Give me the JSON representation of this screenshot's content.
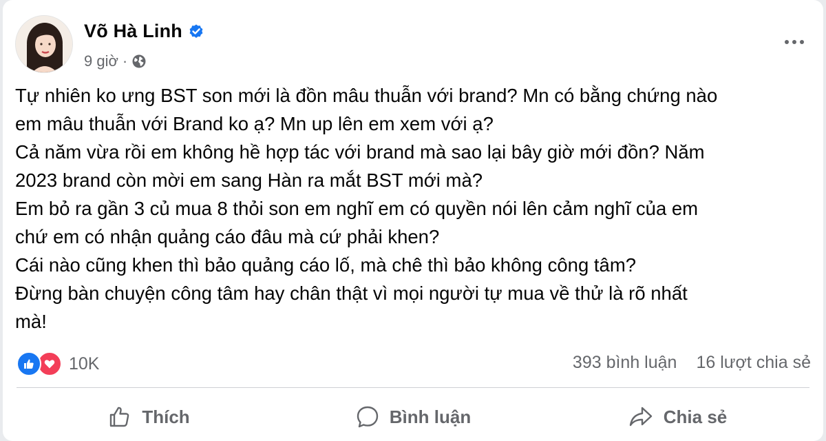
{
  "post": {
    "author": "Võ Hà Linh",
    "time": "9 giờ",
    "separator": "·",
    "lines": [
      "Tự nhiên ko ưng BST son mới là đồn mâu thuẫn với brand? Mn có bằng chứng nào",
      "em mâu thuẫn với Brand ko ạ? Mn up lên em xem với ạ?",
      "Cả năm vừa rồi em không hề hợp tác với brand mà sao lại bây giờ mới đồn? Năm",
      "2023 brand còn mời em sang Hàn ra mắt BST mới mà?",
      "Em bỏ ra gần 3 củ mua 8 thỏi son em nghĩ em có quyền nói lên cảm nghĩ của em",
      "chứ em có nhận quảng cáo đâu mà cứ phải khen?",
      "Cái nào cũng khen thì bảo quảng cáo lố, mà chê thì bảo không công tâm?",
      "Đừng bàn chuyện công tâm hay chân thật vì mọi người tự mua về thử là rõ nhất",
      "mà!"
    ]
  },
  "stats": {
    "reactions": "10K",
    "comments": "393 bình luận",
    "shares": "16 lượt chia sẻ"
  },
  "actions": {
    "like": "Thích",
    "comment": "Bình luận",
    "share": "Chia sẻ"
  },
  "colors": {
    "facebook_blue": "#1877f2",
    "love_red": "#f33e58",
    "secondary_text": "#65676b"
  },
  "icons": {
    "verified": "verified-badge-icon",
    "audience": "globe-icon",
    "more": "more-options-icon",
    "like_reaction": "like-reaction-icon",
    "love_reaction": "love-reaction-icon",
    "like_action": "thumbs-up-icon",
    "comment_action": "comment-bubble-icon",
    "share_action": "share-arrow-icon"
  }
}
